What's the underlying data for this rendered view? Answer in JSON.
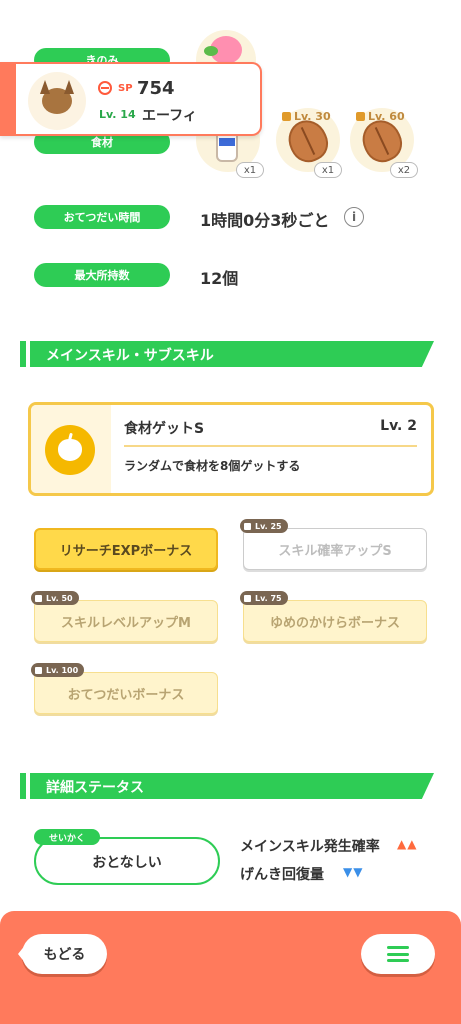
{
  "profile": {
    "sp_label": "SP",
    "sp_value": "754",
    "level": "Lv. 14",
    "name": "エーフィ"
  },
  "labels": {
    "berry": "きのみ",
    "ingredient": "食材",
    "help_time": "おてつだい時間",
    "max_carry": "最大所持数"
  },
  "values": {
    "help_time": "1時間0分3秒ごと",
    "max_carry": "12個"
  },
  "ingredients": [
    {
      "icon": "milk-bottle-icon",
      "qty": "x1",
      "lock": ""
    },
    {
      "icon": "cacao-bean-icon",
      "qty": "x1",
      "lock": "Lv. 30"
    },
    {
      "icon": "cacao-bean-icon",
      "qty": "x2",
      "lock": "Lv. 60"
    }
  ],
  "sections": {
    "skills": "メインスキル・サブスキル",
    "details": "詳細ステータス"
  },
  "main_skill": {
    "name": "食材ゲットS",
    "level": "Lv. 2",
    "description": "ランダムで食材を8個ゲットする",
    "icon": "apple-icon"
  },
  "sub_skills": [
    {
      "label": "リサーチEXPボーナス",
      "lock": ""
    },
    {
      "label": "スキル確率アップS",
      "lock": "Lv. 25"
    },
    {
      "label": "スキルレベルアップM",
      "lock": "Lv. 50"
    },
    {
      "label": "ゆめのかけらボーナス",
      "lock": "Lv. 75"
    },
    {
      "label": "おてつだいボーナス",
      "lock": "Lv. 100"
    }
  ],
  "nature": {
    "tag": "せいかく",
    "value": "おとなしい",
    "up_stat": "メインスキル発生確率",
    "up_arrows": "▲▲",
    "down_stat": "げんき回復量",
    "down_arrows": "▼▼"
  },
  "nav": {
    "back_label": "もどる",
    "menu_icon": "hamburger-menu-icon"
  },
  "colors": {
    "accent_green": "#2ecc55",
    "accent_orange": "#ff7a5c",
    "skill_yellow": "#ffd94a",
    "up_arrow": "#ff6a3d",
    "down_arrow": "#3b8fe8"
  }
}
